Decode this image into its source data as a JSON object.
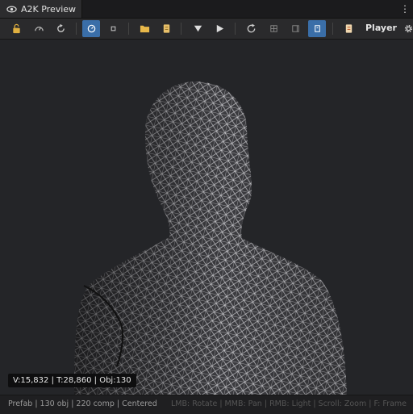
{
  "window": {
    "tab_title": "A2K Preview",
    "menu_glyph": "⋮"
  },
  "toolbar": {
    "buttons": [
      {
        "name": "lock-icon",
        "active": false
      },
      {
        "name": "gauge-icon",
        "active": false
      },
      {
        "name": "reset-rotation-icon",
        "active": false
      },
      {
        "name": "speed-icon",
        "active": true
      },
      {
        "name": "square-icon",
        "active": false
      },
      {
        "name": "folder-icon",
        "active": false
      },
      {
        "name": "document-icon",
        "active": false
      },
      {
        "name": "triangle-down-icon",
        "active": false
      },
      {
        "name": "play-icon",
        "active": false
      },
      {
        "name": "refresh-icon",
        "active": false
      },
      {
        "name": "grid-icon",
        "active": false
      },
      {
        "name": "frame-icon",
        "active": false
      },
      {
        "name": "panel-icon",
        "active": true
      },
      {
        "name": "prefab-doc-icon",
        "active": false
      },
      {
        "name": "gear-icon",
        "active": false
      }
    ],
    "player_label": "Player"
  },
  "viewport": {
    "stats": "V:15,832 | T:28,860 | Obj:130"
  },
  "status": {
    "left": "Prefab | 130 obj | 220 comp | Centered",
    "right": "LMB: Rotate | MMB: Pan | RMB: Light | Scroll: Zoom | F: Frame"
  },
  "colors": {
    "accent": "#3a6ea8",
    "viewport_bg": "#242528",
    "mesh": "#c8c8cc"
  }
}
